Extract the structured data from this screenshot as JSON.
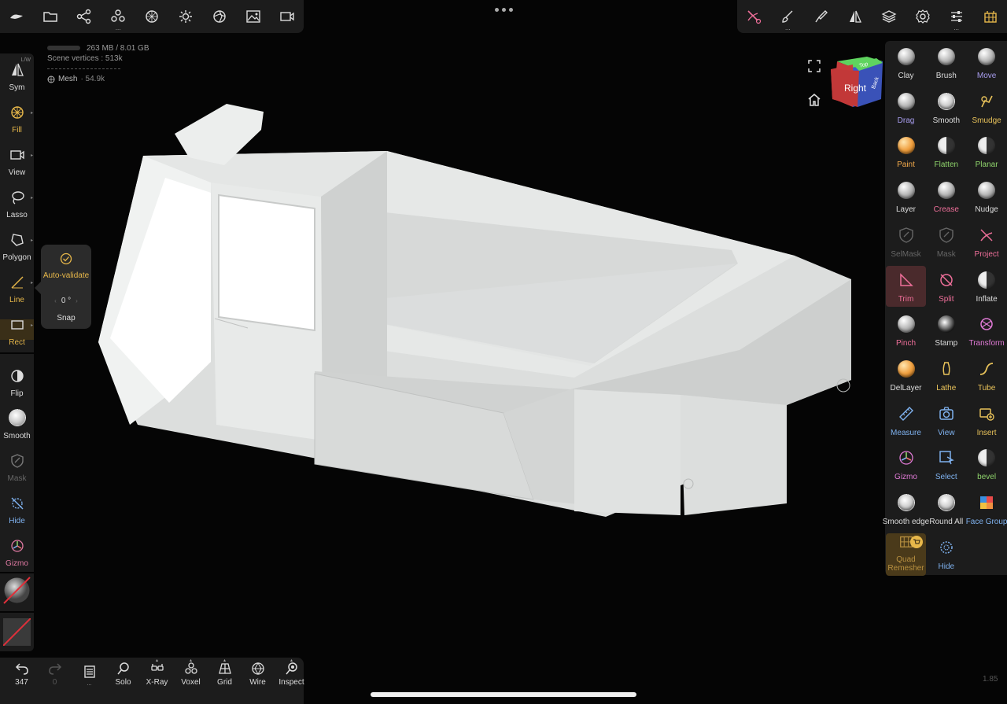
{
  "top_toolbar_left": [
    "logo-icon",
    "folder-icon",
    "scene-tree-icon",
    "primitives-icon",
    "material-icon",
    "light-icon",
    "camera-settings-icon",
    "background-icon",
    "video-icon"
  ],
  "top_toolbar_right": [
    "trim-tool-icon",
    "brush-icon",
    "paint-picker-icon",
    "symmetry-icon",
    "layers-icon",
    "settings-icon",
    "sliders-icon",
    "quad-icon"
  ],
  "stats": {
    "memory": "263 MB / 8.01 GB",
    "scene_vertices": "Scene vertices : 513k",
    "mesh_label": "Mesh",
    "mesh_count": "· 54.9k"
  },
  "view_cube": {
    "right": "Right",
    "back": "Back",
    "top": "Top"
  },
  "left_bar": {
    "sym_label": "Sym",
    "sym_badge": "L/W",
    "fill_label": "Fill",
    "view_label": "View",
    "lasso_label": "Lasso",
    "polygon_label": "Polygon",
    "line_label": "Line",
    "rect_label": "Rect",
    "flip_label": "Flip",
    "smooth_label": "Smooth",
    "mask_label": "Mask",
    "hide_label": "Hide",
    "gizmo_label": "Gizmo"
  },
  "snap_popup": {
    "auto_validate": "Auto-validate",
    "angle": "0 °",
    "snap": "Snap"
  },
  "tools": [
    {
      "label": "Clay",
      "color": "white"
    },
    {
      "label": "Brush",
      "color": "white"
    },
    {
      "label": "Move",
      "color": "purple"
    },
    {
      "label": "Drag",
      "color": "purple"
    },
    {
      "label": "Smooth",
      "color": "white"
    },
    {
      "label": "Smudge",
      "color": "yellow"
    },
    {
      "label": "Paint",
      "color": "orange"
    },
    {
      "label": "Flatten",
      "color": "green"
    },
    {
      "label": "Planar",
      "color": "green"
    },
    {
      "label": "Layer",
      "color": "white"
    },
    {
      "label": "Crease",
      "color": "pink"
    },
    {
      "label": "Nudge",
      "color": "white"
    },
    {
      "label": "SelMask",
      "color": "dim"
    },
    {
      "label": "Mask",
      "color": "dim"
    },
    {
      "label": "Project",
      "color": "pink"
    },
    {
      "label": "Trim",
      "color": "pink"
    },
    {
      "label": "Split",
      "color": "pink"
    },
    {
      "label": "Inflate",
      "color": "white"
    },
    {
      "label": "Pinch",
      "color": "pink"
    },
    {
      "label": "Stamp",
      "color": "white"
    },
    {
      "label": "Transform",
      "color": "magenta"
    },
    {
      "label": "DelLayer",
      "color": "white"
    },
    {
      "label": "Lathe",
      "color": "yellow"
    },
    {
      "label": "Tube",
      "color": "yellow"
    },
    {
      "label": "Measure",
      "color": "blue"
    },
    {
      "label": "View",
      "color": "blue"
    },
    {
      "label": "Insert",
      "color": "yellow"
    },
    {
      "label": "Gizmo",
      "color": "magenta"
    },
    {
      "label": "Select",
      "color": "blue"
    },
    {
      "label": "bevel",
      "color": "green"
    },
    {
      "label": "Smooth edge",
      "color": "white"
    },
    {
      "label": "Round All",
      "color": "white"
    },
    {
      "label": "Face Group",
      "color": "blue"
    },
    {
      "label": "Quad\nRemesher",
      "color": "premium"
    },
    {
      "label": "Hide",
      "color": "blue"
    }
  ],
  "bottom_bar": {
    "undo_count": "347",
    "redo_count": "0",
    "history_label": "...",
    "solo": "Solo",
    "xray": "X-Ray",
    "voxel": "Voxel",
    "grid": "Grid",
    "wire": "Wire",
    "inspect": "Inspect"
  },
  "version": "1.85",
  "colors": {
    "accent_yellow": "#e8b84a",
    "trim_active": "#4a2a2c",
    "panel_bg": "#1c1c1c",
    "viewport_bg": "#050505"
  }
}
